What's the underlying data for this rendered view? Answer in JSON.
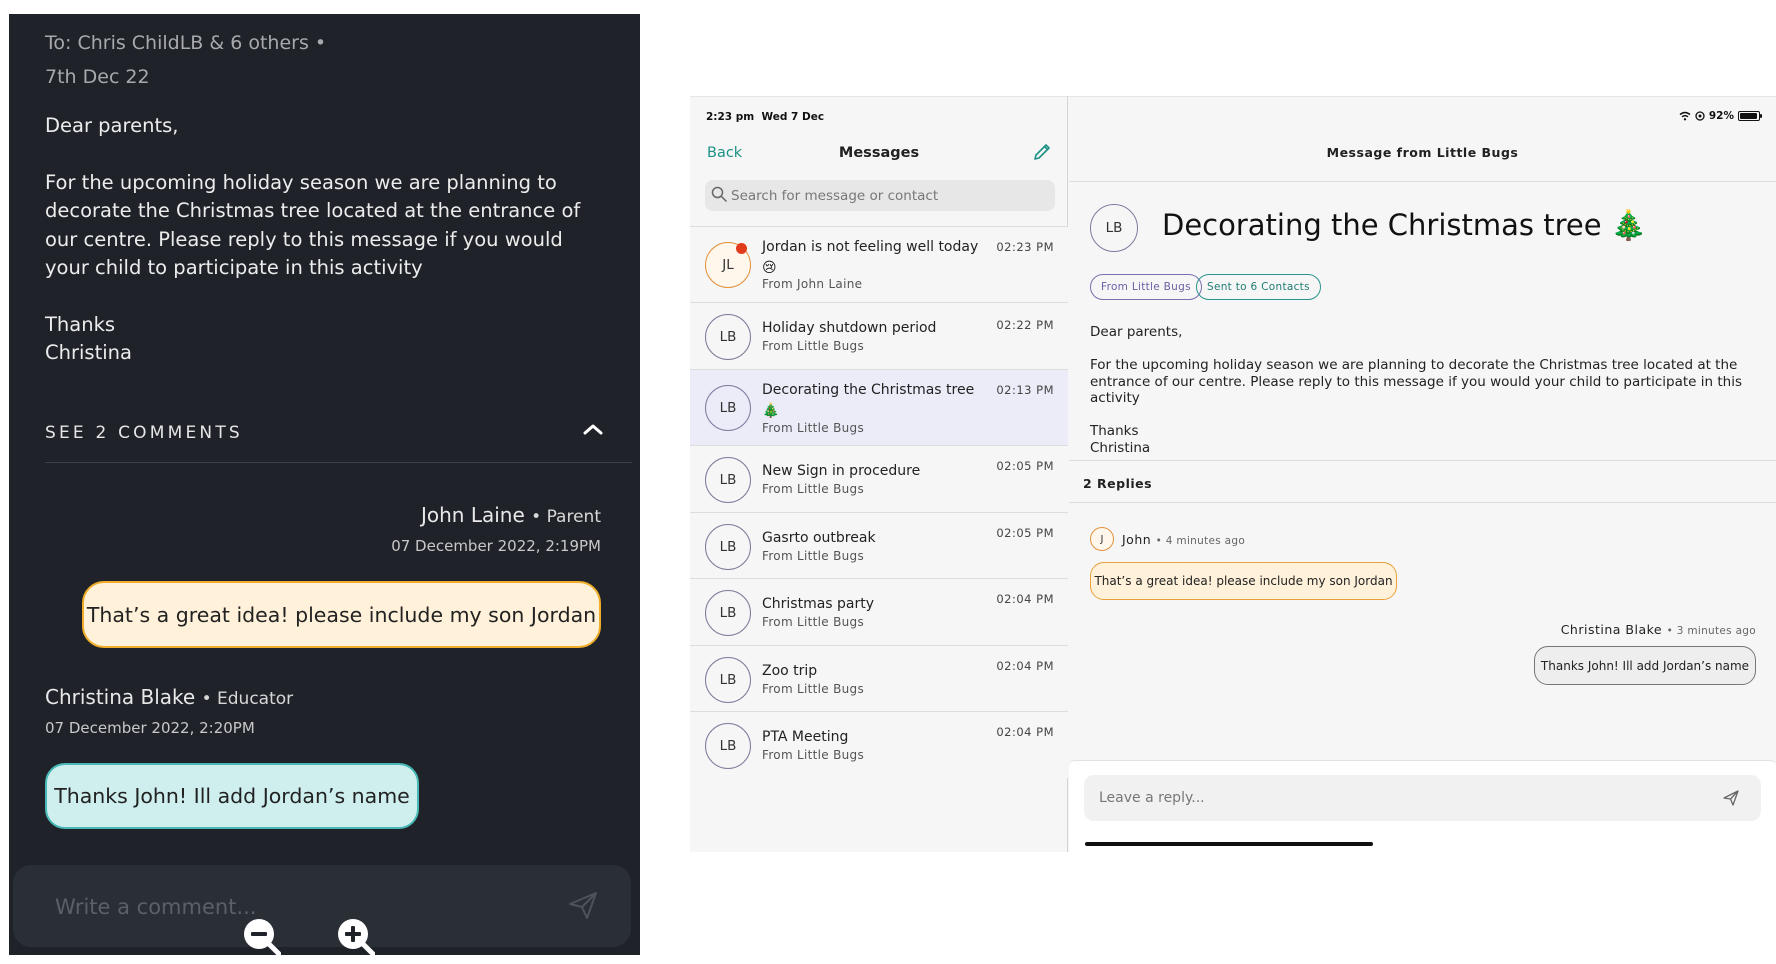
{
  "left": {
    "to_line": "To: Chris ChildLB & 6 others •",
    "date_line": "7th Dec 22",
    "body": [
      "Dear parents,",
      "For the upcoming holiday season we are planning to decorate the Christmas tree located at the entrance of our centre. Please reply to this message if you would your child to participate in this activity",
      "Thanks\nChristina"
    ],
    "see_comments": "SEE 2 COMMENTS",
    "comment1": {
      "name": "John Laine",
      "role": "• Parent",
      "date": "07 December 2022, 2:19PM",
      "text": "That’s a great idea! please include my son Jordan"
    },
    "comment2": {
      "name": "Christina Blake",
      "role": "• Educator",
      "date": "07 December 2022, 2:20PM",
      "text": "Thanks John! Ill add Jordan’s name"
    },
    "compose_placeholder": "Write a comment..."
  },
  "tablet": {
    "status": {
      "time": "2:23 pm  Wed 7 Dec",
      "battery": "92%",
      "battery_level": 0.92
    },
    "list": {
      "back": "Back",
      "title": "Messages",
      "search_placeholder": "Search for message or contact",
      "items": [
        {
          "initials": "JL",
          "subject": "Jordan is not feeling well today 😢",
          "from": "From John Laine",
          "time": "02:23 PM",
          "unread": true
        },
        {
          "initials": "LB",
          "subject": "Holiday shutdown period",
          "from": "From Little Bugs",
          "time": "02:22 PM"
        },
        {
          "initials": "LB",
          "subject": "Decorating the Christmas tree 🎄",
          "from": "From Little Bugs",
          "time": "02:13 PM",
          "selected": true
        },
        {
          "initials": "LB",
          "subject": "New Sign in procedure",
          "from": "From Little Bugs",
          "time": "02:05 PM"
        },
        {
          "initials": "LB",
          "subject": "Gasrto outbreak",
          "from": "From Little Bugs",
          "time": "02:05 PM"
        },
        {
          "initials": "LB",
          "subject": "Christmas party",
          "from": "From Little Bugs",
          "time": "02:04 PM"
        },
        {
          "initials": "LB",
          "subject": "Zoo trip",
          "from": "From Little Bugs",
          "time": "02:04 PM"
        },
        {
          "initials": "LB",
          "subject": "PTA Meeting",
          "from": "From Little Bugs",
          "time": "02:04 PM"
        }
      ]
    },
    "detail": {
      "header": "Message from Little Bugs",
      "avatar": "LB",
      "subject": "Decorating the Christmas tree 🎄",
      "chip_from": "From Little Bugs",
      "chip_sent": "Sent to 6 Contacts",
      "body": [
        "Dear parents,",
        "For the upcoming holiday season we are planning to decorate the Christmas tree located at the entrance of our centre. Please reply to this message if you would your child to participate in this activity",
        "Thanks\nChristina"
      ],
      "replies_label": "2 Replies",
      "reply1": {
        "avatar": "J",
        "name": "John",
        "meta": "• 4 minutes ago",
        "text": "That’s a great idea! please include my son Jordan"
      },
      "reply2": {
        "name": "Christina Blake",
        "meta": "• 3 minutes ago",
        "text": "Thanks John! Ill add Jordan’s name"
      },
      "reply_placeholder": "Leave a reply..."
    }
  },
  "colors": {
    "accent": "#1d9186",
    "dark_bg": "#1f2329",
    "parent_bubble": "#fff1da",
    "educator_bubble": "#cfeeee",
    "unread_dot": "#e23b1c"
  },
  "icons": [
    "chevron-up-icon",
    "send-icon",
    "zoom-out-icon",
    "zoom-in-icon",
    "compose-icon",
    "search-icon",
    "wifi-icon",
    "battery-icon"
  ]
}
